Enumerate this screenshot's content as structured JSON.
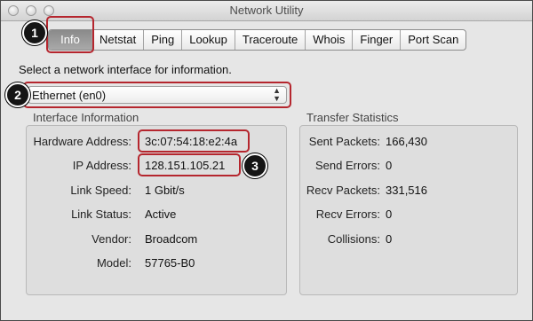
{
  "window": {
    "title": "Network Utility"
  },
  "tabs": [
    {
      "label": "Info",
      "selected": true
    },
    {
      "label": "Netstat"
    },
    {
      "label": "Ping"
    },
    {
      "label": "Lookup"
    },
    {
      "label": "Traceroute"
    },
    {
      "label": "Whois"
    },
    {
      "label": "Finger"
    },
    {
      "label": "Port Scan"
    }
  ],
  "prompt": "Select a network interface for information.",
  "interface_select": {
    "value": "Ethernet (en0)"
  },
  "interface_info": {
    "title": "Interface Information",
    "rows": [
      {
        "label": "Hardware Address:",
        "value": "3c:07:54:18:e2:4a"
      },
      {
        "label": "IP Address:",
        "value": "128.151.105.21"
      },
      {
        "label": "Link Speed:",
        "value": "1 Gbit/s"
      },
      {
        "label": "Link Status:",
        "value": "Active"
      },
      {
        "label": "Vendor:",
        "value": "Broadcom"
      },
      {
        "label": "Model:",
        "value": "57765-B0"
      }
    ]
  },
  "transfer_stats": {
    "title": "Transfer Statistics",
    "rows": [
      {
        "label": "Sent Packets:",
        "value": "166,430"
      },
      {
        "label": "Send Errors:",
        "value": "0"
      },
      {
        "label": "Recv Packets:",
        "value": "331,516"
      },
      {
        "label": "Recv Errors:",
        "value": "0"
      },
      {
        "label": "Collisions:",
        "value": "0"
      }
    ]
  },
  "callouts": [
    "1",
    "2",
    "3"
  ],
  "colors": {
    "highlight": "#b5262e",
    "selected_tab": "#999999"
  }
}
